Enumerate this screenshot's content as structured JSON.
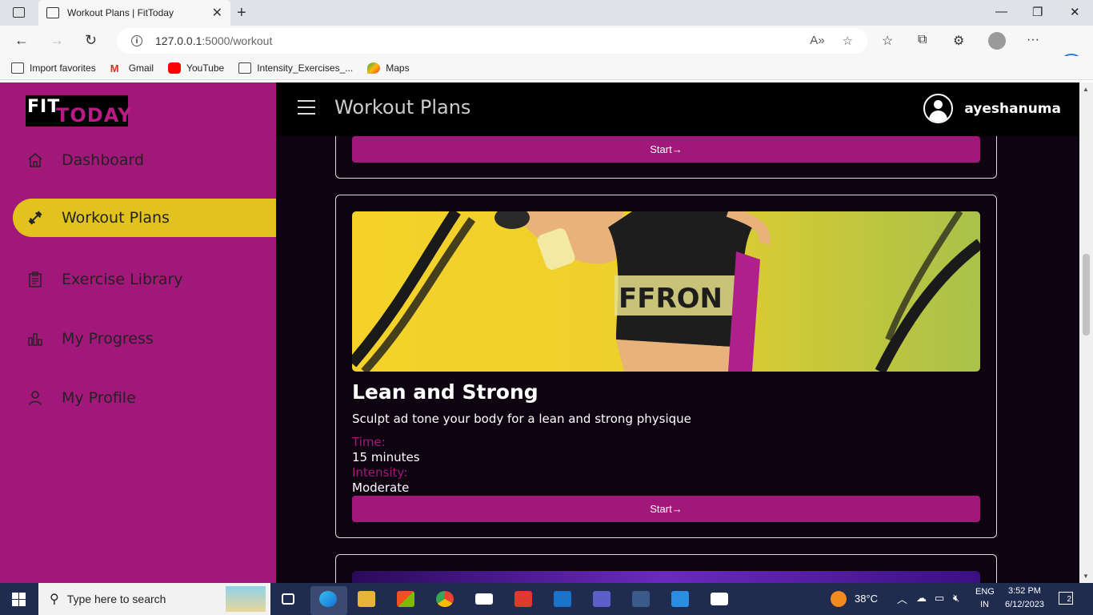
{
  "browser": {
    "tab_title": "Workout Plans | FitToday",
    "url_host": "127.0.0.1",
    "url_path": ":5000/workout",
    "favorites": [
      "Import favorites",
      "Gmail",
      "YouTube",
      "Intensity_Exercises_...",
      "Maps"
    ]
  },
  "app": {
    "logo_fit": "FIT",
    "logo_today": "TODAY",
    "page_title": "Workout Plans",
    "username": "ayeshanuma",
    "nav": [
      {
        "label": "Dashboard",
        "icon": "home-icon"
      },
      {
        "label": "Workout Plans",
        "icon": "dumbbell-icon",
        "active": true
      },
      {
        "label": "Exercise Library",
        "icon": "clipboard-icon"
      },
      {
        "label": "My Progress",
        "icon": "bar-chart-icon"
      },
      {
        "label": "My Profile",
        "icon": "user-icon"
      }
    ],
    "start_label": "Start→",
    "plan": {
      "title": "Lean and Strong",
      "description": "Sculpt ad tone your body for a lean and strong physique",
      "time_label": "Time:",
      "time_value": "15 minutes",
      "intensity_label": "Intensity:",
      "intensity_value": "Moderate"
    },
    "accent_color": "#a2187a",
    "active_color": "#e2c21d"
  },
  "taskbar": {
    "search_placeholder": "Type here to search",
    "temperature": "38°C",
    "lang_1": "ENG",
    "lang_2": "IN",
    "time": "3:52 PM",
    "date": "6/12/2023",
    "notifications": "2"
  }
}
